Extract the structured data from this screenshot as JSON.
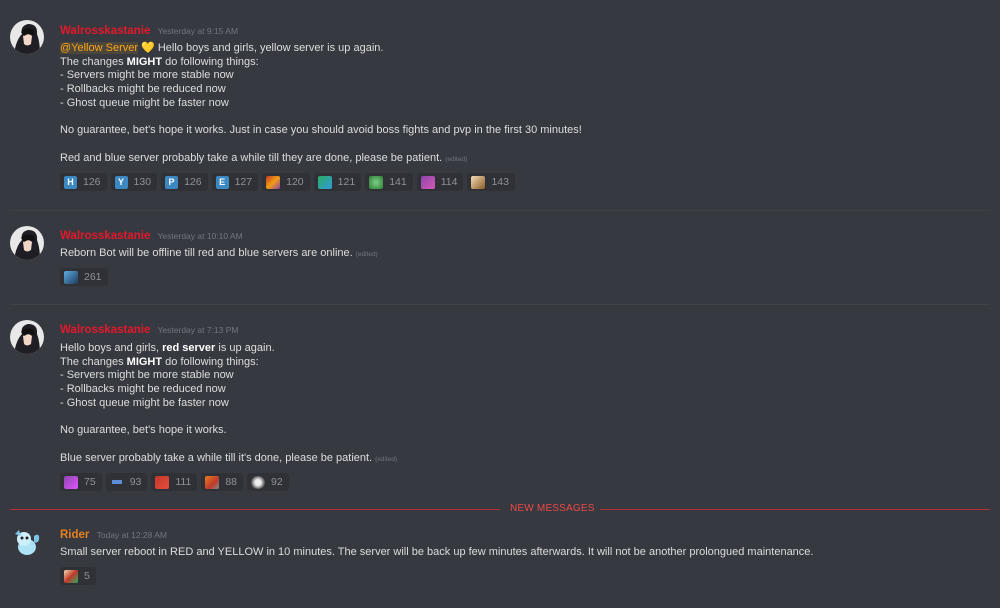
{
  "colors": {
    "background": "#36393f",
    "walross_name": "#e5182b",
    "rider_name": "#e67e22",
    "new_messages": "#f04747",
    "mention": "#faa61a"
  },
  "messages": [
    {
      "author": "Walrosskastanie",
      "timestamp": "Yesterday at 9:15 AM",
      "avatar_icon": "dark-haired-character-avatar",
      "mention": "@Yellow Server",
      "mention_emoji": "yellow-heart-icon",
      "line1_rest": " Hello boys and girls, yellow server is up again.",
      "line2_pre": "The changes ",
      "line2_bold": "MIGHT",
      "line2_post": " do following things:",
      "bullets": [
        "- Servers might be more stable now",
        "- Rollbacks might be reduced now",
        "- Ghost queue might be faster now"
      ],
      "para2": "No guarantee, bet's hope it works. Just in case you should avoid boss fights and pvp in the first 30 minutes!",
      "para3": "Red and blue server probably take a while till they are done, please be patient.",
      "edited": "(edited)",
      "reactions": [
        {
          "icon": "regional-indicator-h-icon",
          "letter": "H",
          "count": "126"
        },
        {
          "icon": "regional-indicator-y-icon",
          "letter": "Y",
          "count": "130"
        },
        {
          "icon": "regional-indicator-p-icon",
          "letter": "P",
          "count": "126"
        },
        {
          "icon": "regional-indicator-e-icon",
          "letter": "E",
          "count": "127"
        },
        {
          "icon": "custom-emoji-1-icon",
          "count": "120"
        },
        {
          "icon": "custom-emoji-2-icon",
          "count": "121"
        },
        {
          "icon": "custom-emoji-3-icon",
          "count": "141"
        },
        {
          "icon": "custom-emoji-4-icon",
          "count": "114"
        },
        {
          "icon": "custom-emoji-5-icon",
          "count": "143"
        }
      ]
    },
    {
      "author": "Walrosskastanie",
      "timestamp": "Yesterday at 10:10 AM",
      "text": "Reborn Bot will be offline till red and blue servers are online.",
      "edited": "(edited)",
      "reactions": [
        {
          "icon": "custom-emoji-6-icon",
          "count": "261"
        }
      ]
    },
    {
      "author": "Walrosskastanie",
      "timestamp": "Yesterday at 7:13 PM",
      "line1_pre": "Hello boys and girls, ",
      "line1_bold": "red server",
      "line1_post": " is up again.",
      "line2_pre": "The changes ",
      "line2_bold": "MIGHT",
      "line2_post": " do following things:",
      "bullets": [
        "- Servers might be more stable now",
        "- Rollbacks might be reduced now",
        "- Ghost queue might be faster now"
      ],
      "para2": "No guarantee, bet's hope it works.",
      "para3": "Blue server probably take a while till it's done, please be patient.",
      "edited": "(edited)",
      "reactions": [
        {
          "icon": "custom-emoji-7-icon",
          "count": "75"
        },
        {
          "icon": "custom-emoji-8-icon",
          "count": "93"
        },
        {
          "icon": "custom-emoji-9-icon",
          "count": "111"
        },
        {
          "icon": "custom-emoji-10-icon",
          "count": "88"
        },
        {
          "icon": "custom-emoji-11-icon",
          "count": "92"
        }
      ]
    }
  ],
  "new_messages_label": "NEW MESSAGES",
  "rider_message": {
    "author": "Rider",
    "timestamp": "Today at 12:28 AM",
    "avatar_icon": "blue-creature-avatar",
    "text": "Small server reboot in RED and YELLOW in 10 minutes. The server will be back up few minutes afterwards. It will not be another prolongued maintenance.",
    "reactions": [
      {
        "icon": "custom-emoji-12-icon",
        "count": "5"
      }
    ]
  }
}
